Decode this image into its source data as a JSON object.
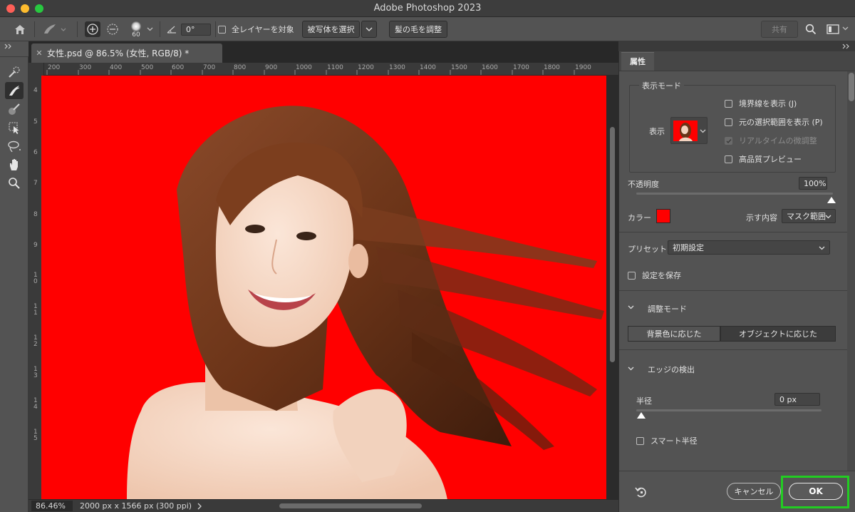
{
  "window": {
    "title": "Adobe Photoshop 2023"
  },
  "options_bar": {
    "brush_size": "60",
    "angle_value": "0°",
    "sample_all_layers_label": "全レイヤーを対象",
    "select_subject_label": "被写体を選択",
    "refine_hair_label": "髪の毛を調整",
    "share_label": "共有"
  },
  "document": {
    "tab_title": "女性.psd @ 86.5% (女性, RGB/8) *",
    "ruler_h_labels": [
      "200",
      "300",
      "400",
      "500",
      "600",
      "700",
      "800",
      "900",
      "1000",
      "1100",
      "1200",
      "1300",
      "1400",
      "1500",
      "1600",
      "1700",
      "1800",
      "1900"
    ],
    "ruler_v_labels": [
      "4",
      "5",
      "6",
      "7",
      "8",
      "9",
      "1\n0",
      "1\n1",
      "1\n2",
      "1\n3",
      "1\n4",
      "1\n5"
    ],
    "zoom_level": "86.46%",
    "doc_size": "2000 px x 1566 px (300 ppi)"
  },
  "properties_panel": {
    "tab_label": "属性",
    "view_mode_group_label": "表示モード",
    "view_label": "表示",
    "show_edge_label": "境界線を表示 (J)",
    "show_original_label": "元の選択範囲を表示 (P)",
    "realtime_refine_label": "リアルタイムの微調整",
    "high_quality_preview_label": "高品質プレビュー",
    "opacity_label": "不透明度",
    "opacity_value": "100%",
    "opacity_level": 1.0,
    "color_label": "カラー",
    "overlay_color": "#ff0000",
    "indicates_label": "示す内容",
    "indicates_value": "マスク範囲",
    "preset_label": "プリセット",
    "preset_value": "初期設定",
    "save_settings_label": "設定を保存",
    "refine_mode_label": "調整モード",
    "refine_mode_options": [
      "背景色に応じた",
      "オブジェクトに応じた"
    ],
    "edge_detection_label": "エッジの検出",
    "radius_label": "半径",
    "radius_value": "0 px",
    "radius_level": 0,
    "smart_radius_label": "スマート半径",
    "cancel_label": "キャンセル",
    "ok_label": "OK"
  }
}
